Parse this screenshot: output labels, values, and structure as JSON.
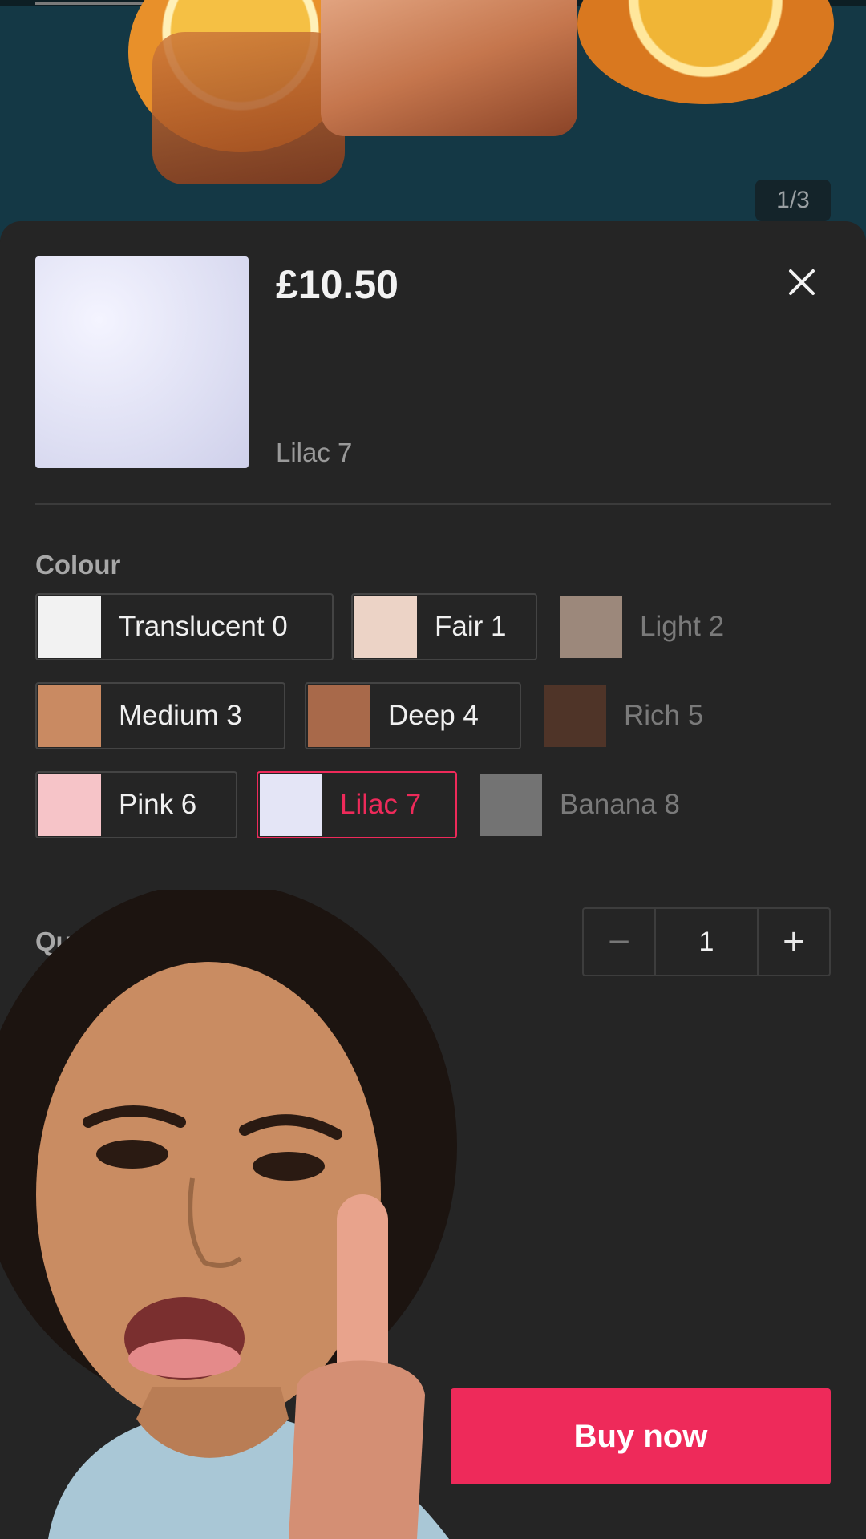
{
  "media": {
    "counter": "1/3",
    "progress_fraction": 0.2
  },
  "product": {
    "price": "£10.50",
    "selected_variant": "Lilac 7"
  },
  "colour": {
    "label": "Colour",
    "options": [
      {
        "label": "Translucent 0",
        "swatch": "#f2f2f2",
        "state": "available"
      },
      {
        "label": "Fair 1",
        "swatch": "#ecd3c6",
        "state": "available"
      },
      {
        "label": "Light 2",
        "swatch": "#c4a998",
        "state": "unavailable"
      },
      {
        "label": "Medium 3",
        "swatch": "#c98a62",
        "state": "available"
      },
      {
        "label": "Deep 4",
        "swatch": "#a8694a",
        "state": "available"
      },
      {
        "label": "Rich 5",
        "swatch": "#5e3a2a",
        "state": "unavailable"
      },
      {
        "label": "Pink 6",
        "swatch": "#f6c4c8",
        "state": "available"
      },
      {
        "label": "Lilac 7",
        "swatch": "#e4e5f6",
        "state": "selected"
      },
      {
        "label": "Banana 8",
        "swatch": "#8d8d8d",
        "state": "unavailable"
      }
    ]
  },
  "quantity": {
    "label_visible": "Qua",
    "value": "1",
    "minus": "−",
    "plus": "+"
  },
  "actions": {
    "buy_now": "Buy now"
  },
  "colors": {
    "accent": "#ee2a5a",
    "sheet_bg": "#252525"
  }
}
